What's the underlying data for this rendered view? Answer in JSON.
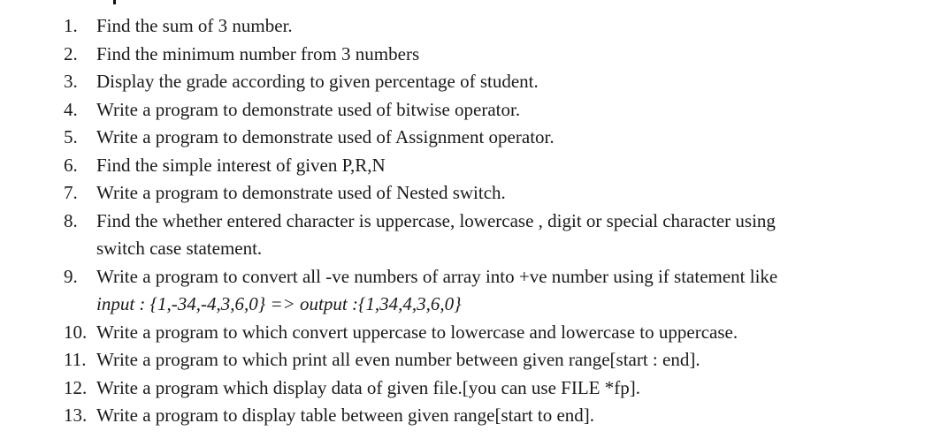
{
  "questions": [
    {
      "num": "1.",
      "text": "Find the sum of 3 number."
    },
    {
      "num": "2.",
      "text": "Find the minimum number from 3 numbers"
    },
    {
      "num": "3.",
      "text": "Display the grade according to given percentage of student."
    },
    {
      "num": "4.",
      "text": "Write a program to demonstrate used of bitwise operator."
    },
    {
      "num": "5.",
      "text": "Write a program to demonstrate used of Assignment operator."
    },
    {
      "num": "6.",
      "text": "Find the simple interest of given P,R,N"
    },
    {
      "num": "7.",
      "text": "Write a program to demonstrate used of Nested switch."
    },
    {
      "num": "8.",
      "text": "Find the whether entered character is uppercase, lowercase , digit or special character using",
      "cont": "switch case statement."
    },
    {
      "num": "9.",
      "text": "Write a program to convert all -ve numbers of array into +ve number  using if statement like",
      "cont": "input : {1,-34,-4,3,6,0} => output :{1,34,4,3,6,0}"
    },
    {
      "num": "10.",
      "text": "Write a program to which convert uppercase to lowercase and lowercase to uppercase."
    },
    {
      "num": "11.",
      "text": "Write a program to which print all even number between given range[start : end]."
    },
    {
      "num": "12.",
      "text": "Write a program which display data of given file.[you can use FILE *fp]."
    },
    {
      "num": "13.",
      "text": "Write a program to display table between given range[start to end]."
    }
  ]
}
